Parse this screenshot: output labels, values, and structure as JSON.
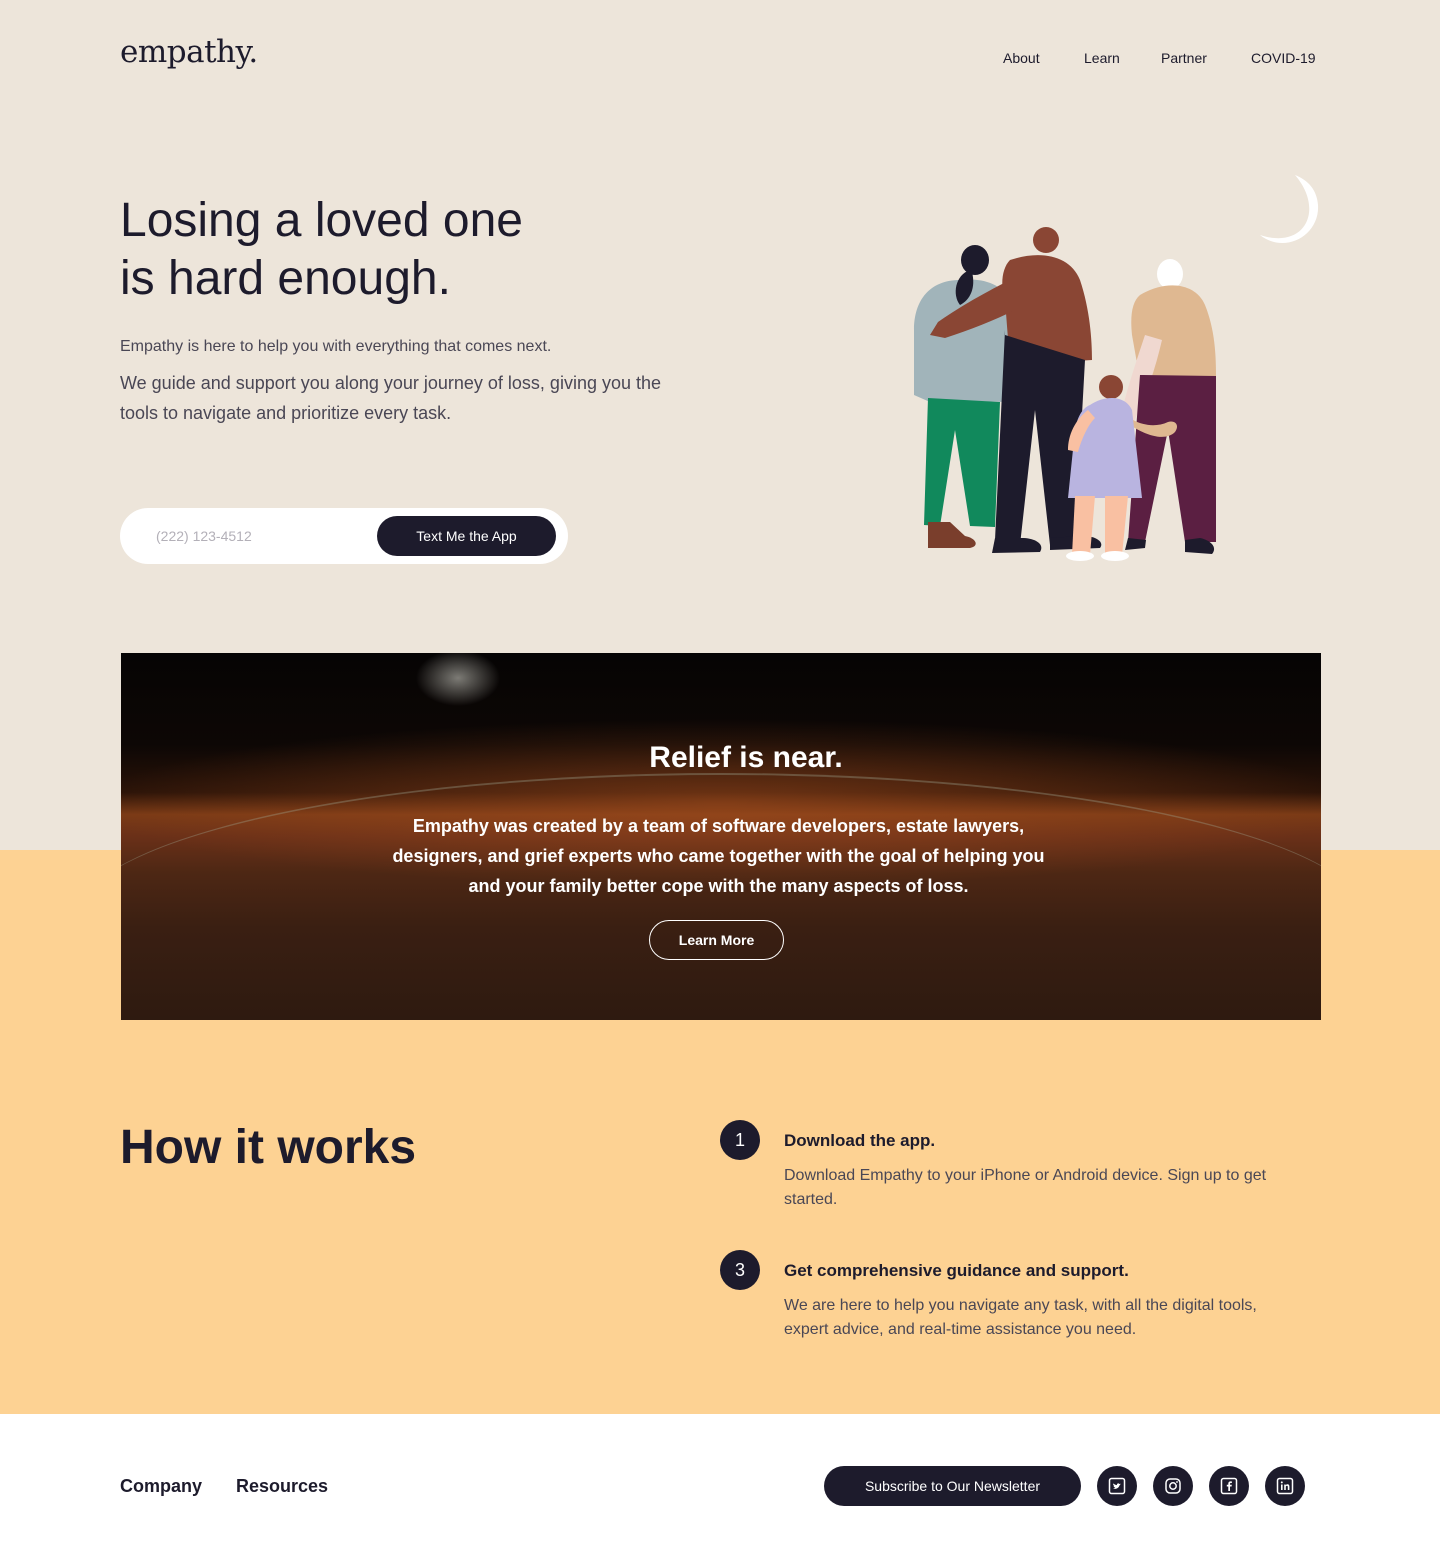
{
  "brand": {
    "logo": "empathy."
  },
  "nav": {
    "items": [
      {
        "label": "About"
      },
      {
        "label": "Learn"
      },
      {
        "label": "Partner"
      },
      {
        "label": "COVID-19"
      }
    ]
  },
  "hero": {
    "title_line1": "Losing a loved one",
    "title_line2": "is hard enough.",
    "sub1": "Empathy is here to help you with everything that comes next.",
    "sub2": "We guide and support you along your journey of loss, giving you the tools to navigate and prioritize every task.",
    "phone_placeholder": "(222) 123-4512",
    "cta": "Text Me the App"
  },
  "banner": {
    "title": "Relief is near.",
    "text": "Empathy was created by a team of software developers, estate lawyers, designers, and grief experts who came together with the goal of helping you and your family better cope with the many aspects of loss.",
    "button": "Learn More"
  },
  "how": {
    "title": "How it works",
    "steps": [
      {
        "number": "1",
        "title": "Download the app.",
        "desc": "Download Empathy to your iPhone or Android device. Sign up to get started."
      },
      {
        "number": "3",
        "title": "Get comprehensive guidance and support.",
        "desc": "We are here to help you navigate any task, with all the digital tools, expert advice, and real-time assistance you need."
      }
    ]
  },
  "footer": {
    "links": [
      {
        "label": "Company"
      },
      {
        "label": "Resources"
      }
    ],
    "newsletter": "Subscribe to Our Newsletter",
    "social_icons": [
      "twitter-icon",
      "instagram-icon",
      "facebook-icon",
      "linkedin-icon"
    ]
  },
  "colors": {
    "background": "#ede5da",
    "accent_yellow": "#fdd293",
    "dark": "#1d1b2c",
    "white": "#ffffff"
  }
}
